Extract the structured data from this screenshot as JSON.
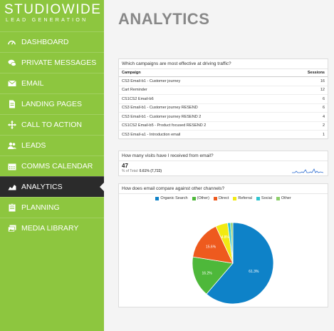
{
  "brand": {
    "name": "STUDIOWIDE",
    "tagline": "LEAD GENERATION"
  },
  "nav": [
    {
      "label": "DASHBOARD",
      "icon": "gauge-icon",
      "active": false
    },
    {
      "label": "PRIVATE MESSAGES",
      "icon": "chat-bubbles-icon",
      "active": false
    },
    {
      "label": "EMAIL",
      "icon": "envelope-icon",
      "active": false
    },
    {
      "label": "LANDING PAGES",
      "icon": "document-icon",
      "active": false
    },
    {
      "label": "CALL TO ACTION",
      "icon": "crosshair-arrows-icon",
      "active": false
    },
    {
      "label": "LEADS",
      "icon": "users-icon",
      "active": false
    },
    {
      "label": "COMMS CALENDAR",
      "icon": "calendar-icon",
      "active": false
    },
    {
      "label": "ANALYTICS",
      "icon": "area-chart-icon",
      "active": true
    },
    {
      "label": "PLANNING",
      "icon": "clipboard-icon",
      "active": false
    },
    {
      "label": "MEDIA LIBRARY",
      "icon": "images-icon",
      "active": false
    }
  ],
  "page": {
    "title": "ANALYTICS"
  },
  "campaigns": {
    "question": "Which campaigns are most effective at driving traffic?",
    "col_campaign": "Campaign",
    "col_sessions": "Sessions",
    "rows": [
      {
        "name": "CS3 Email-b1 - Customer journey",
        "sessions": "16"
      },
      {
        "name": "Cart Reminder",
        "sessions": "12"
      },
      {
        "name": "CS1CS2 Email-b6",
        "sessions": "6"
      },
      {
        "name": "CS3 Email-b1 - Customer journey RESEND",
        "sessions": "6"
      },
      {
        "name": "CS3 Email-b1 - Customer journey RESEND 2",
        "sessions": "4"
      },
      {
        "name": "CS1CS2 Email-b5 - Product focused RESEND 2",
        "sessions": "2"
      },
      {
        "name": "CS3 Email-a1 - Introduction email",
        "sessions": "1"
      }
    ]
  },
  "visits": {
    "question": "How many visits have I received from email?",
    "value": "47",
    "subtext_prefix": "% of Total: ",
    "subtext_value": "0.61% (7,722)"
  },
  "channels": {
    "question": "How does email compare against other channels?",
    "chart_data": {
      "type": "pie",
      "categories": [
        "Organic Search",
        "(Other)",
        "Direct",
        "Referral",
        "Social",
        "Other"
      ],
      "values": [
        61.3,
        16.2,
        15.6,
        4.8,
        1.2,
        0.9
      ],
      "labels": [
        "61.3%",
        "16.2%",
        "15.6%",
        "4.8%",
        "",
        ""
      ],
      "colors": [
        "#0e82c8",
        "#4eb83a",
        "#ee5a1e",
        "#f2ea12",
        "#2ec5d0",
        "#8dcf6a"
      ]
    }
  }
}
